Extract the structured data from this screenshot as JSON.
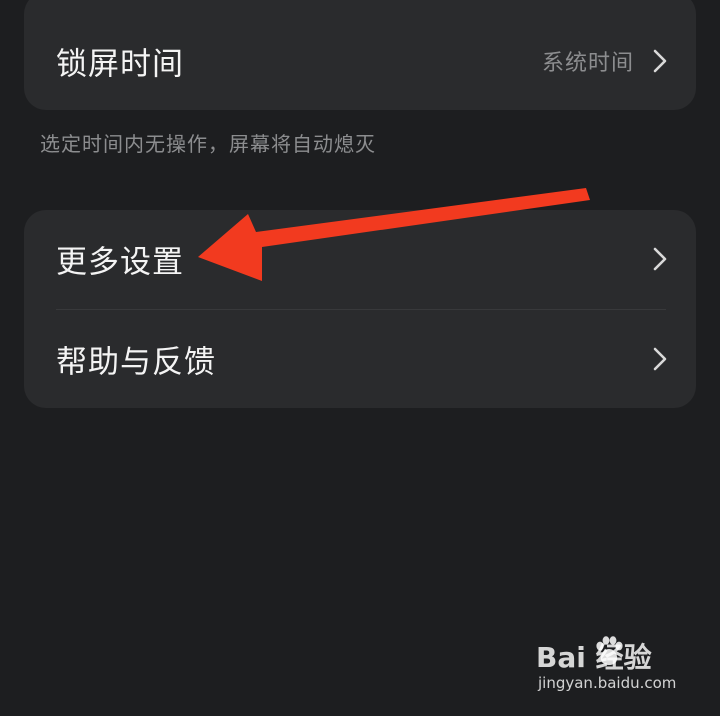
{
  "lock_card": {
    "label": "锁屏时间",
    "value": "系统时间"
  },
  "hint_text": "选定时间内无操作，屏幕将自动熄灭",
  "more_card": {
    "items": [
      {
        "label": "更多设置"
      },
      {
        "label": "帮助与反馈"
      }
    ]
  },
  "annotation": {
    "arrow_color": "#f23a1f"
  },
  "watermark": {
    "logo_text": "Bai 经验",
    "url": "jingyan.baidu.com"
  },
  "colors": {
    "background": "#1d1e20",
    "card": "#2a2b2d",
    "secondary_text": "#8c8d8f"
  }
}
